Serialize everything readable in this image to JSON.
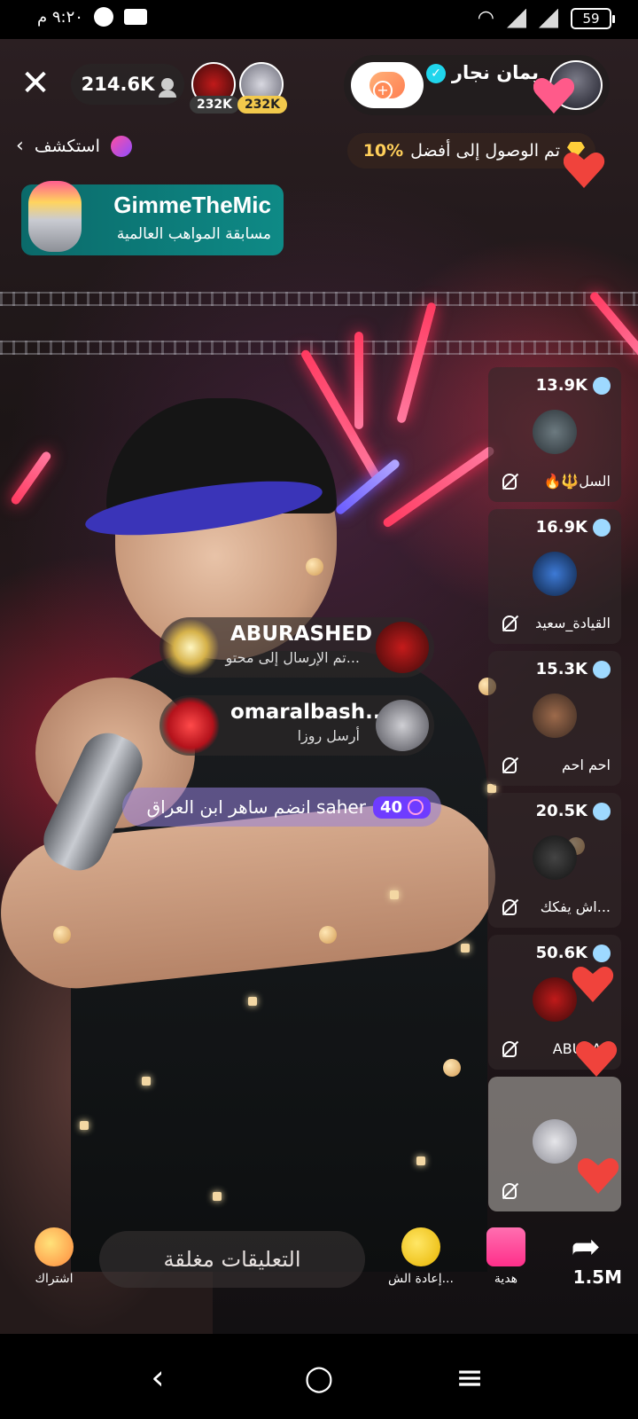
{
  "status_bar": {
    "time": "٩:٢٠ م",
    "battery": "59",
    "icons": [
      "snapchat-icon",
      "video-icon",
      "wifi-icon",
      "no-signal-icon",
      "no-signal-icon",
      "battery-icon"
    ]
  },
  "header": {
    "viewer_count": "214.6K",
    "top_viewers": [
      {
        "badge": "232K",
        "badge_color": "#3a3a3a"
      },
      {
        "badge": "232K",
        "badge_color": "#f2c94c"
      }
    ],
    "host_name": "يمان نجار",
    "rank_text": "تم الوصول إلى أفضل",
    "rank_percent": "10%",
    "explore_label": "استكشف"
  },
  "promo": {
    "title": "GimmeTheMic",
    "subtitle": "مسابقة المواهب العالمية"
  },
  "guests": [
    {
      "score": "13.9K",
      "name": "🔥🔱السل"
    },
    {
      "score": "16.9K",
      "name": "القيادة_سعيد"
    },
    {
      "score": "15.3K",
      "name": "احم احم"
    },
    {
      "score": "20.5K",
      "name": "اش يفكك..."
    },
    {
      "score": "50.6K",
      "name": "ABURAS"
    },
    {
      "score": "",
      "name": ""
    }
  ],
  "gifts": [
    {
      "username": "ABURASHED",
      "text": "تم الإرسال إلى محتو..."
    },
    {
      "username": "omaralbash...",
      "text": "أرسل روزا"
    }
  ],
  "join": {
    "level": "40",
    "text": "انضم ساهر ابن العراق saher"
  },
  "bottom": {
    "subscribe_label": "اشتراك",
    "comment_placeholder": "التعليقات مغلقة",
    "repost_label": "إعادة الش...",
    "gift_label": "هدية",
    "share_count": "1.5M"
  },
  "colors": {
    "accent_red": "#f0433c",
    "promo_teal": "#0e8a86",
    "rank_gold": "#ffcf5a",
    "level_purple": "#6e3cff"
  }
}
